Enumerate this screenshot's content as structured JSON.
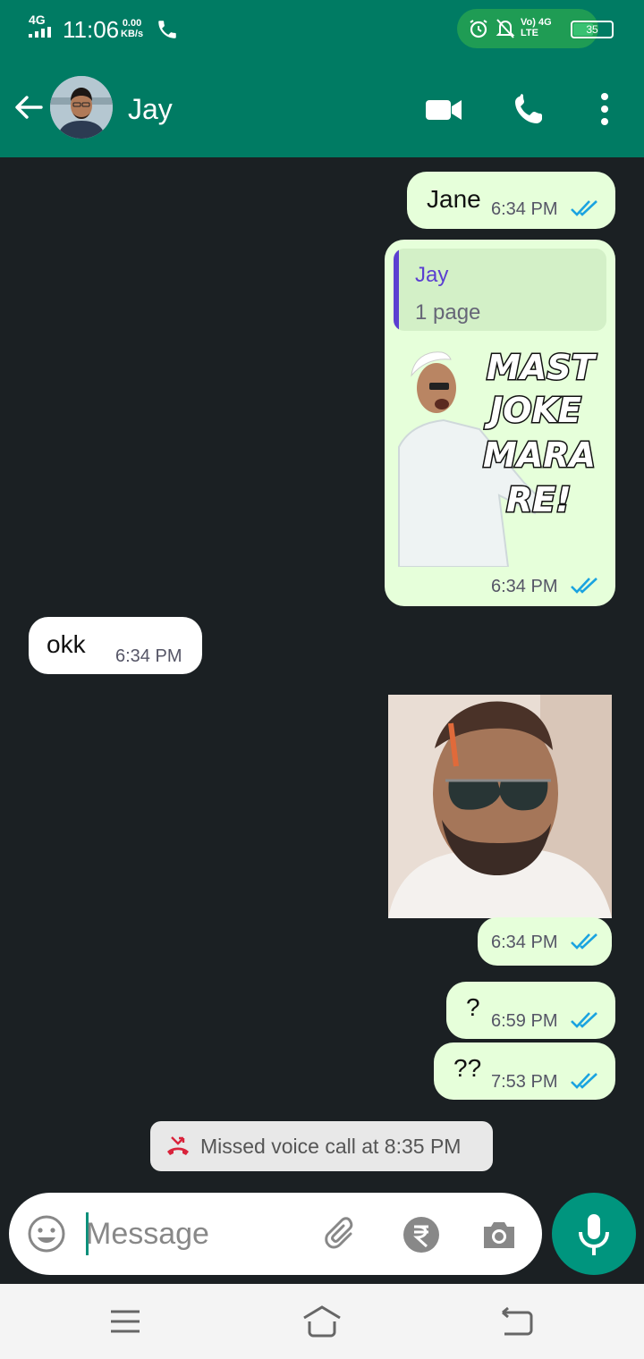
{
  "status_bar": {
    "network": "4G",
    "time": "11:06",
    "speed_value": "0.00",
    "speed_unit": "KB/s",
    "volte": "Vo)",
    "lte_top": "4G",
    "lte_bottom": "LTE",
    "battery": "35"
  },
  "header": {
    "contact_name": "Jay"
  },
  "messages": [
    {
      "direction": "out",
      "text": "Jane",
      "time": "6:34 PM",
      "status": "read"
    },
    {
      "direction": "out",
      "reply_to_name": "Jay",
      "reply_to_text": "1 page",
      "sticker_lines": [
        "MAST",
        "JOKE",
        "MARA",
        "RE!"
      ],
      "time": "6:34 PM",
      "status": "read"
    },
    {
      "direction": "in",
      "text": "okk",
      "time": "6:34 PM"
    },
    {
      "direction": "out",
      "type": "sticker",
      "time": "6:34 PM",
      "status": "read"
    },
    {
      "direction": "out",
      "text": "?",
      "time": "6:59 PM",
      "status": "read"
    },
    {
      "direction": "out",
      "text": "??",
      "time": "7:53 PM",
      "status": "read"
    }
  ],
  "system_notice": {
    "text": "Missed voice call at 8:35 PM"
  },
  "composer": {
    "placeholder": "Message"
  },
  "colors": {
    "header": "#007b63",
    "chat_bg": "#1b2023",
    "bubble_out": "#e6ffda",
    "bubble_in": "#ffffff",
    "read_ticks": "#1aa3e0",
    "mic_button": "#00957e",
    "missed_call": "#d9233b"
  },
  "icons": {
    "back": "arrow-left-icon",
    "video": "video-camera-icon",
    "call": "phone-icon",
    "menu": "more-vertical-icon",
    "emoji": "emoji-icon",
    "attach": "paperclip-icon",
    "payment": "rupee-icon",
    "camera": "camera-icon",
    "mic": "microphone-icon",
    "missed": "missed-call-icon"
  }
}
